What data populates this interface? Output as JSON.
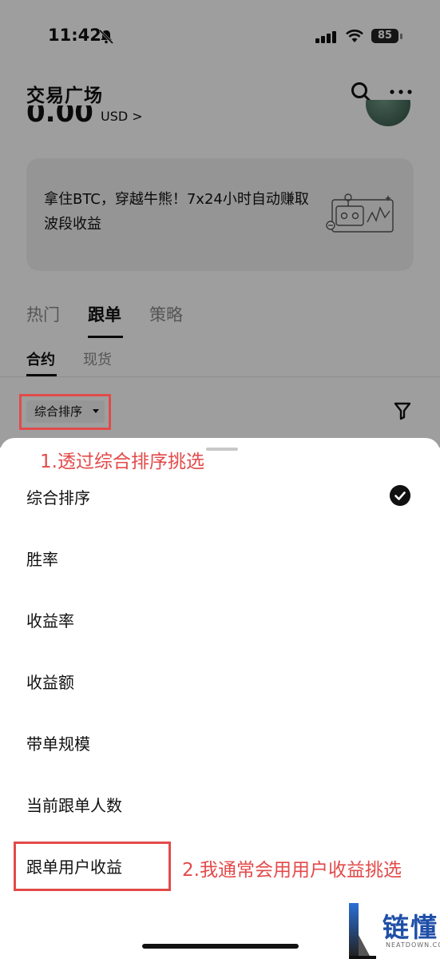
{
  "status_bar": {
    "time": "11:42",
    "battery": "85"
  },
  "header": {
    "title": "交易广场"
  },
  "balance": {
    "amount": "0.00",
    "unit": "USD >"
  },
  "banner": {
    "text": "拿住BTC，穿越牛熊！7x24小时自动赚取波段收益"
  },
  "tabs": [
    {
      "label": "热门"
    },
    {
      "label": "跟单",
      "active": true
    },
    {
      "label": "策略"
    }
  ],
  "subtabs": [
    {
      "label": "合约",
      "active": true
    },
    {
      "label": "现货"
    }
  ],
  "sort": {
    "label": "综合排序"
  },
  "sheet": {
    "options": [
      {
        "label": "综合排序",
        "selected": true
      },
      {
        "label": "胜率"
      },
      {
        "label": "收益率"
      },
      {
        "label": "收益额"
      },
      {
        "label": "带单规模"
      },
      {
        "label": "当前跟单人数"
      },
      {
        "label": "跟单用户收益"
      }
    ]
  },
  "annotations": {
    "note1": "1.透过综合排序挑选",
    "note2": "2.我通常会用用户收益挑选"
  },
  "watermark": {
    "text": "链懂",
    "sub": "NEATDOWN.COM"
  },
  "colors": {
    "annotation": "#e34a4a",
    "accent": "#111111",
    "watermark": "#1f4fa8"
  }
}
